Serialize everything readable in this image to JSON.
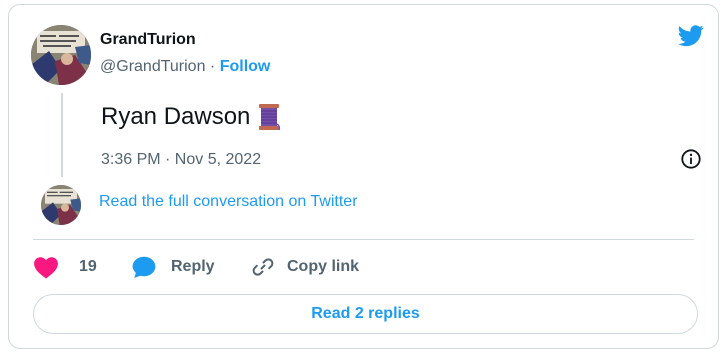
{
  "author": {
    "display_name": "GrandTurion",
    "handle": "@GrandTurion",
    "separator": "·",
    "follow_label": "Follow"
  },
  "tweet": {
    "text": "Ryan Dawson",
    "emoji": "spool-of-thread-emoji",
    "timestamp": "3:36 PM · Nov 5, 2022"
  },
  "conversation": {
    "link_label": "Read the full conversation on Twitter"
  },
  "actions": {
    "like_count": "19",
    "reply_label": "Reply",
    "copy_link_label": "Copy link"
  },
  "replies_button": {
    "label": "Read 2 replies"
  },
  "colors": {
    "accent": "#1d9bf0",
    "like": "#f91880",
    "text_secondary": "#536471",
    "border": "#cfd9de"
  },
  "icons": {
    "brand": "twitter-bird-icon",
    "info": "info-icon",
    "like": "heart-icon",
    "reply": "speech-bubble-icon",
    "copy": "link-icon"
  }
}
